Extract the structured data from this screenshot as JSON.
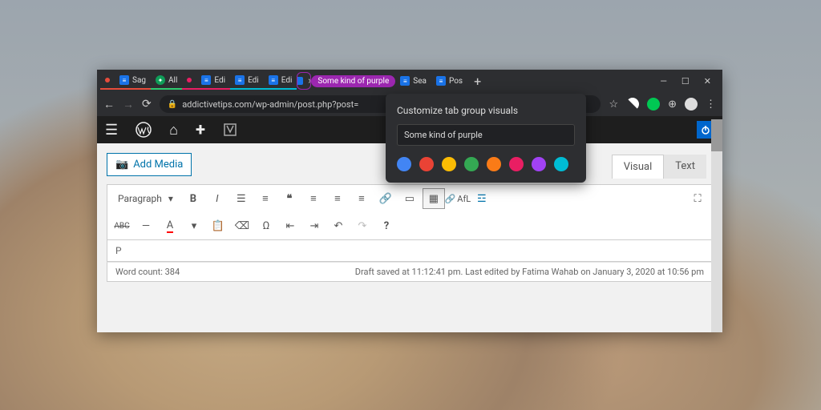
{
  "tabs": [
    {
      "label": "Sag"
    },
    {
      "label": "All"
    },
    {
      "label": "Edi"
    },
    {
      "label": "Edi"
    },
    {
      "label": "Edi"
    },
    {
      "label": "Sea"
    },
    {
      "label": "Pos"
    }
  ],
  "group_pill": "Some kind of purple",
  "url": "addictivetips.com/wp-admin/post.php?post=",
  "popup": {
    "title": "Customize tab group visuals",
    "input_value": "Some kind of purple",
    "colors": [
      "#4285f4",
      "#ea4335",
      "#fbbc04",
      "#34a853",
      "#fa7b17",
      "#e91e63",
      "#a142f4",
      "#00bcd4"
    ]
  },
  "wp": {
    "add_media": "Add Media",
    "visual_tab": "Visual",
    "text_tab": "Text",
    "format": "Paragraph",
    "afl": "AfL",
    "path": "P",
    "word_count": "Word count: 384",
    "status": "Draft saved at 11:12:41 pm. Last edited by Fatima Wahab on January 3, 2020 at 10:56 pm"
  }
}
